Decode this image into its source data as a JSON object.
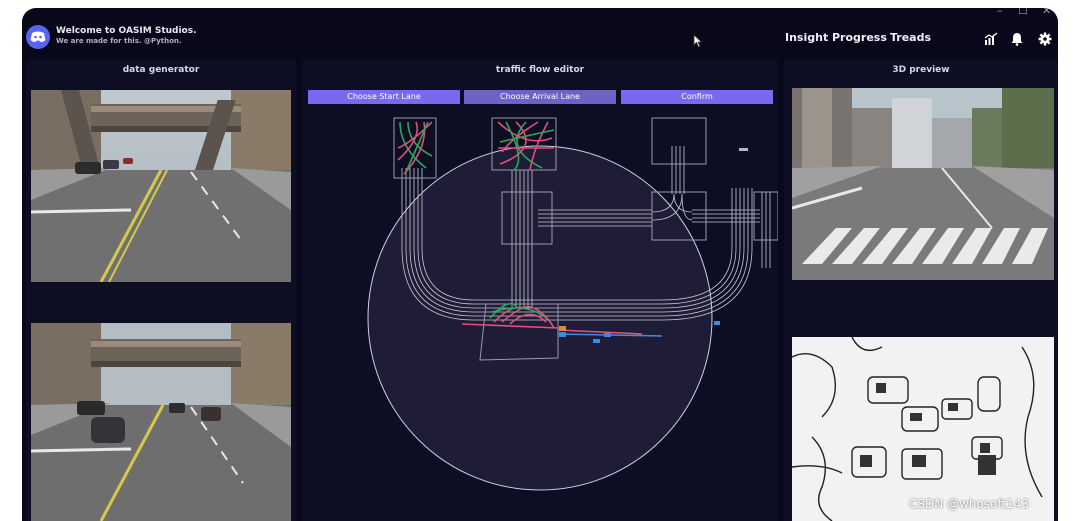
{
  "app": {
    "title": "Welcome to OASIM Studios.",
    "subtitle": "We are made for this. @Python."
  },
  "nav": {
    "insight": "Insight",
    "progress": "Progress",
    "treads": "Treads"
  },
  "window_controls": {
    "minimize": "–",
    "maximize": "☐",
    "close": "✕"
  },
  "panels": {
    "data_generator": {
      "title": "data generator"
    },
    "traffic_flow_editor": {
      "title": "traffic flow editor",
      "buttons": {
        "choose_start": "Choose Start Lane",
        "choose_arrival": "Choose Arrival Lane",
        "confirm": "Confirm"
      }
    },
    "preview_3d": {
      "title": "3D preview"
    }
  },
  "icons": {
    "logo": "discord-logo-icon",
    "chart": "chart-icon",
    "bell": "bell-icon",
    "settings": "gear-icon",
    "cursor": "mouse-cursor-icon"
  },
  "colors": {
    "background": "#08081a",
    "panel": "#0d0d24",
    "accent": "#7b68ee",
    "lane_red": "#e0507a",
    "lane_green": "#2aa860",
    "lane_blue": "#3a8ce0"
  },
  "watermark": "CSDN @whosoft143"
}
